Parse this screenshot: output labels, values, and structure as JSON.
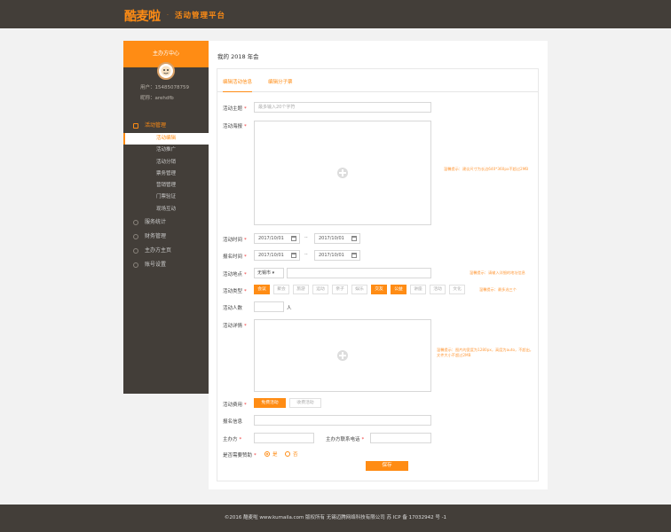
{
  "header": {
    "logo": "酷麦啦",
    "separator": "·",
    "subtitle": "活动管理平台"
  },
  "sidebar": {
    "title": "主办方中心",
    "user_id": "用户：15485078759",
    "nickname": "昵称：arehdfb",
    "groups": [
      {
        "label": "活动管理",
        "active": true
      },
      {
        "label": "服务统计"
      },
      {
        "label": "财务管理"
      },
      {
        "label": "主办方主页"
      },
      {
        "label": "账号设置"
      }
    ],
    "items": [
      {
        "label": "活动编辑",
        "active": true
      },
      {
        "label": "活动推广"
      },
      {
        "label": "活动分销"
      },
      {
        "label": "票务管理"
      },
      {
        "label": "营销管理"
      },
      {
        "label": "门票验证"
      },
      {
        "label": "现场互动"
      }
    ]
  },
  "main": {
    "title": "我的 2018 年会",
    "tabs": [
      {
        "label": "编辑活动信息"
      },
      {
        "label": "编辑分子票"
      }
    ],
    "form": {
      "subject_label": "活动主题",
      "subject_placeholder": "最多输入20个字符",
      "poster_label": "活动海报",
      "poster_hint": "温馨提示：建议尺寸为长边640*360px不超过2MB",
      "time_label": "活动时间",
      "time_start": "2017/10/01",
      "time_end": "2017/10/01",
      "signup_label": "报名时间",
      "signup_start": "2017/10/01",
      "signup_end": "2017/10/01",
      "range_sep": "--",
      "location_label": "活动地点",
      "location_select": "无锡市 ▾",
      "location_hint": "温馨提示：请输入详细的地址信息",
      "type_label": "活动类型",
      "types": [
        {
          "label": "会议",
          "on": true
        },
        {
          "label": "聚会"
        },
        {
          "label": "旅游"
        },
        {
          "label": "运动"
        },
        {
          "label": "亲子"
        },
        {
          "label": "娱乐"
        },
        {
          "label": "交友",
          "on": true
        },
        {
          "label": "公益",
          "on": true
        },
        {
          "label": "讲座"
        },
        {
          "label": "活动"
        },
        {
          "label": "文化"
        }
      ],
      "type_hint": "温馨提示：最多选三个",
      "count_label": "活动人数",
      "count_unit": "人",
      "detail_label": "活动详情",
      "detail_hint": "温馨提示：图片的宽度为1280px，高度为auto，不超出，文件大小不超过2MB",
      "fee_label": "活动费用",
      "fee_free": "免费活动",
      "fee_paid": "收费活动",
      "signup_info_label": "报名信息",
      "organizer_label": "主办方",
      "phone_label": "主办方联系电话",
      "sponsor_label": "是否需要赞助",
      "yes": "是",
      "no": "否",
      "save": "保存"
    }
  },
  "footer": {
    "text": "©2016 酷麦啦 www.kumaila.com 版权所有 无锡迈腾网络科技有限公司 苏 ICP 备 17032942 号 -1"
  },
  "colors": {
    "accent": "#ff8c14",
    "dark": "#433e39"
  }
}
